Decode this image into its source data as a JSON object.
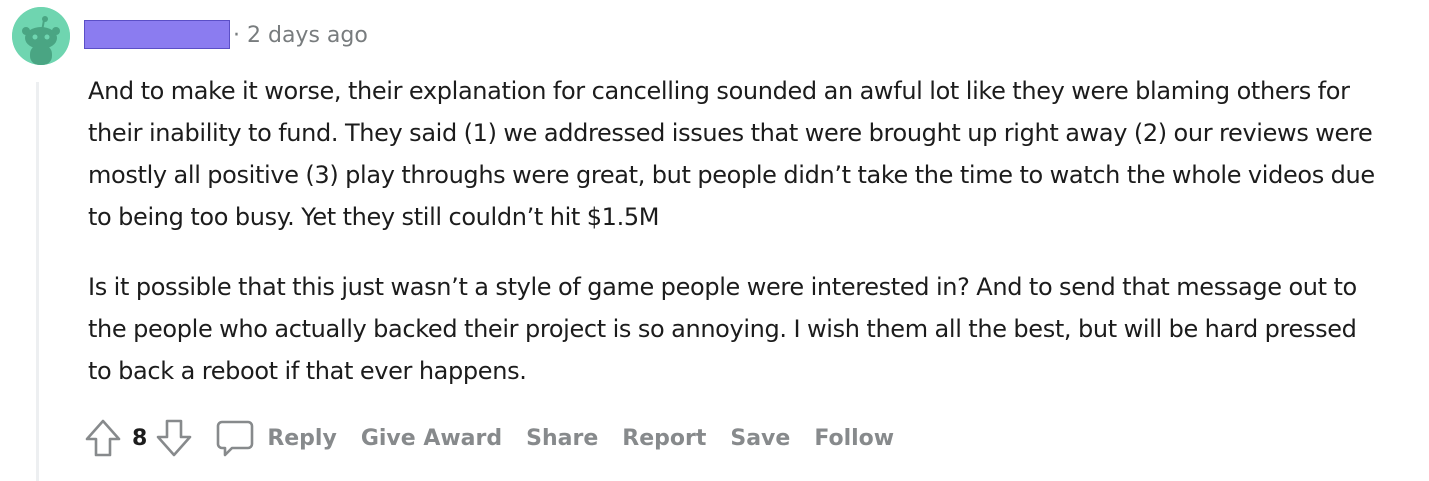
{
  "comment": {
    "username": "",
    "timestamp": "· 2 days ago",
    "paragraphs": [
      "And to make it worse, their explanation for cancelling sounded an awful lot like they were blaming others for their inability to fund. They said (1) we addressed issues that were brought up right away (2) our reviews were mostly all positive (3) play throughs were great, but people didn’t take the time to watch the whole videos due to being too busy. Yet they still couldn’t hit $1.5M",
      "Is it possible that this just wasn’t a style of game people were interested in? And to send that message out to the people who actually backed their project is so annoying. I wish them all the best, but will be hard pressed to back a reboot if that ever happens."
    ],
    "vote_count": "8",
    "actions": {
      "reply": "Reply",
      "give_award": "Give Award",
      "share": "Share",
      "report": "Report",
      "save": "Save",
      "follow": "Follow"
    }
  },
  "colors": {
    "avatar_bg": "#6fd5b0",
    "username_redaction": "#8b7cf0",
    "meta_text": "#787c7e",
    "action_text": "#878a8c",
    "thread_line": "#edeff1"
  },
  "icons": {
    "avatar": "reddit-snoo-icon",
    "upvote": "upvote-arrow-icon",
    "downvote": "downvote-arrow-icon",
    "comment": "comment-bubble-icon"
  }
}
